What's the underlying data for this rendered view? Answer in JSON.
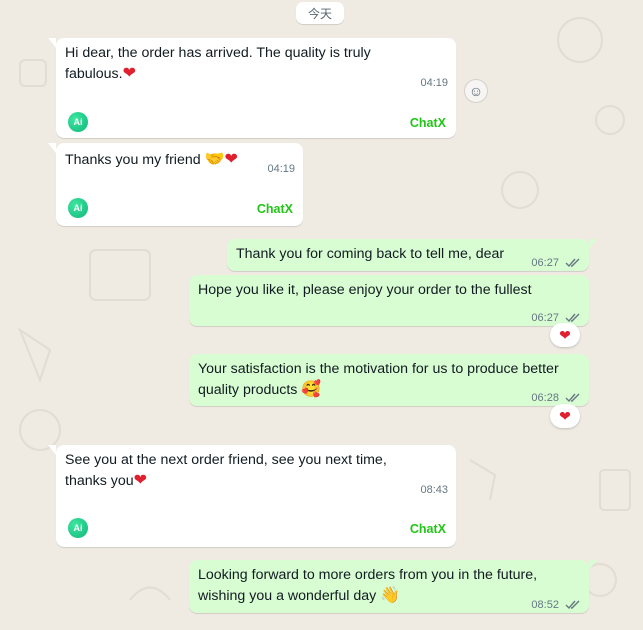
{
  "date_separator": "今天",
  "messages": [
    {
      "id": "m1",
      "direction": "in",
      "text": "Hi dear, the order has arrived. The quality is truly fabulous.",
      "emoji": "❤",
      "time": "04:19",
      "chatx": "ChatX",
      "ai_badge": "Ai"
    },
    {
      "id": "m2",
      "direction": "in",
      "text": "Thanks you my friend ",
      "emoji": "🤝❤",
      "time": "04:19",
      "chatx": "ChatX",
      "ai_badge": "Ai"
    },
    {
      "id": "m3",
      "direction": "out",
      "text": "Thank you for coming back to tell me, dear",
      "time": "06:27"
    },
    {
      "id": "m4",
      "direction": "out",
      "text": "Hope you like it, please enjoy your order to the fullest",
      "time": "06:27",
      "reaction": "❤"
    },
    {
      "id": "m5",
      "direction": "out",
      "text": "Your satisfaction is the motivation for us to produce better quality products ",
      "emoji": "🥰",
      "time": "06:28",
      "reaction": "❤"
    },
    {
      "id": "m6",
      "direction": "in",
      "text": "See you at the next order friend, see you next time, thanks you",
      "emoji": "❤",
      "time": "08:43",
      "chatx": "ChatX",
      "ai_badge": "Ai"
    },
    {
      "id": "m7",
      "direction": "out",
      "text": "Looking forward to more orders from you in the future, wishing you a wonderful day ",
      "emoji": "👋",
      "time": "08:52"
    }
  ],
  "colors": {
    "incoming": "#ffffff",
    "outgoing": "#d9fdd3",
    "chatx_green": "#22c517",
    "background": "#efeae2"
  },
  "icons": {
    "read_receipt": "double-check-icon",
    "react": "smiley-icon"
  }
}
